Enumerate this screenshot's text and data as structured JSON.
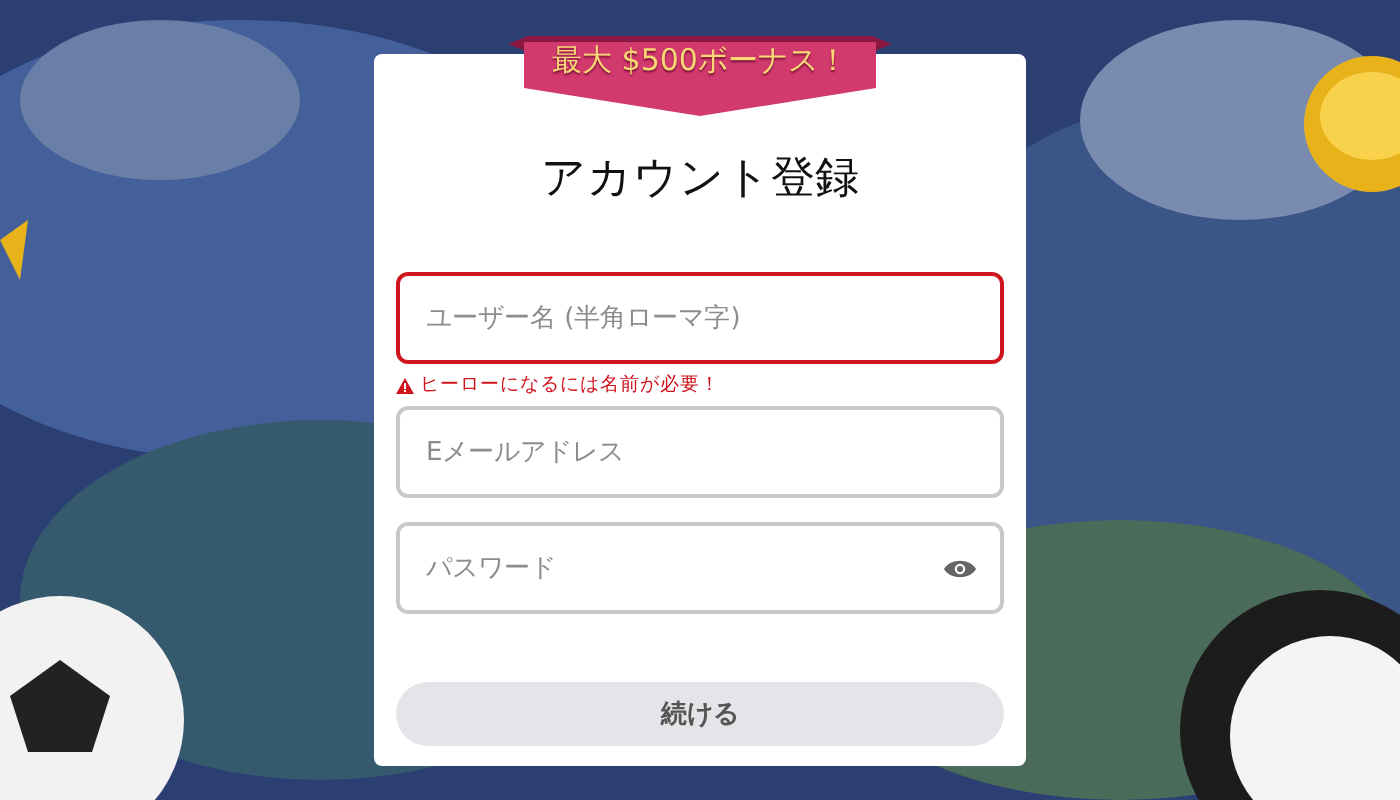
{
  "banner": {
    "text": "最大 $500ボーナス！"
  },
  "title": "アカウント登録",
  "fields": [
    {
      "kind": "text",
      "placeholder": "ユーザー名 (半角ローマ字)",
      "invalid": true,
      "error": "ヒーローになるには名前が必要！"
    },
    {
      "kind": "email",
      "placeholder": "Eメールアドレス",
      "invalid": false
    },
    {
      "kind": "password",
      "placeholder": "パスワード",
      "invalid": false
    }
  ],
  "submit": {
    "label": "続ける",
    "disabled": true
  }
}
